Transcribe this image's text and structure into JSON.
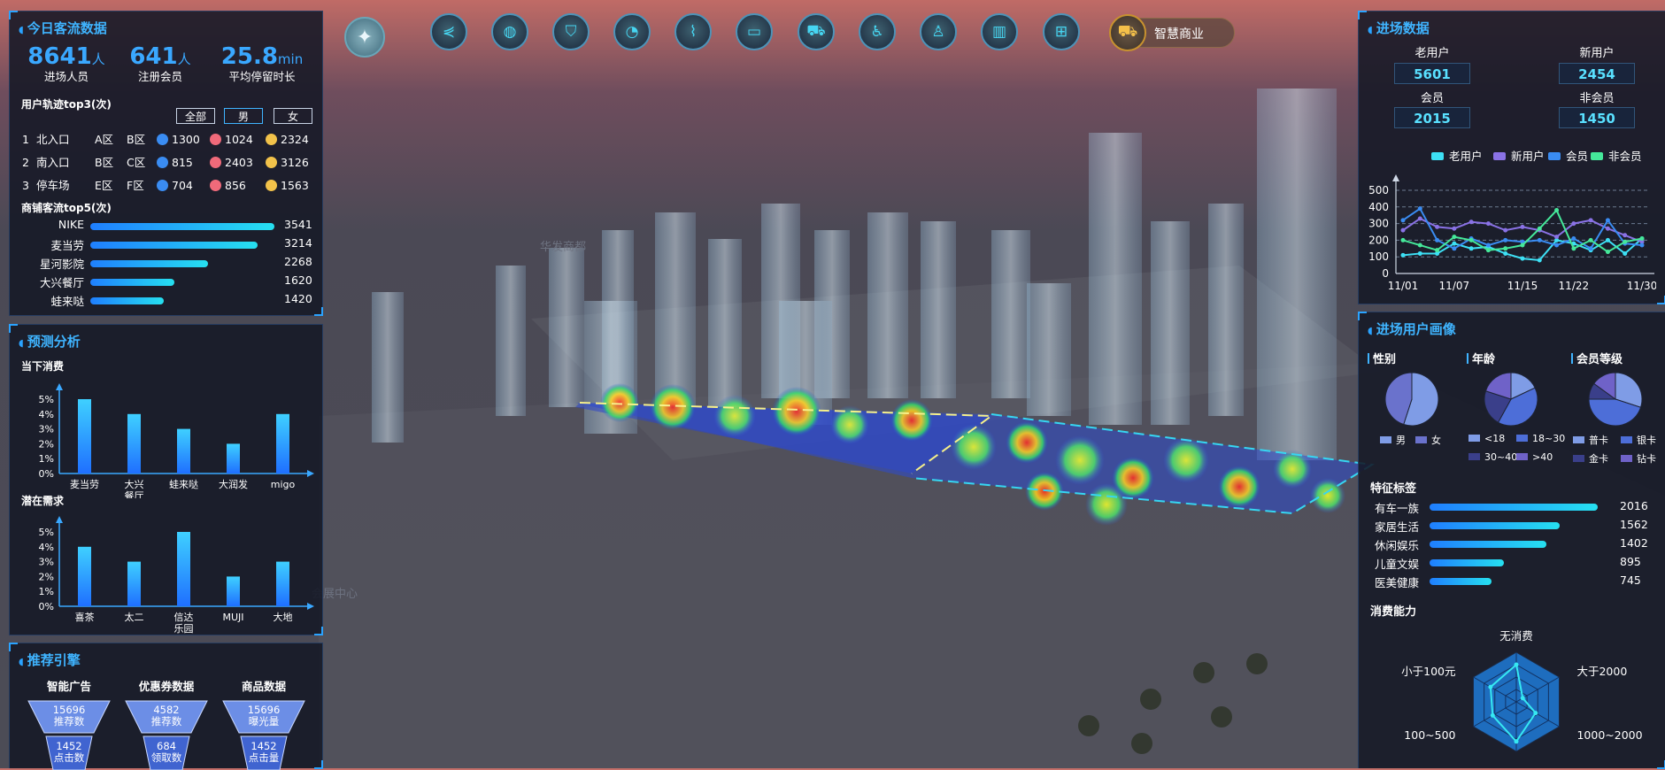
{
  "toolbar": {
    "compass_icon": "compass-icon",
    "icons": [
      "share-icon",
      "globe-icon",
      "shield-icon",
      "speedometer-icon",
      "router-icon",
      "bus-icon",
      "truck-icon",
      "pedestrian-icon",
      "hydrant-icon",
      "building-icon",
      "presentation-icon"
    ],
    "active_label": "智慧商业",
    "active_icon": "shopping-bag-icon"
  },
  "today": {
    "title": "今日客流数据",
    "kpis": [
      {
        "value": "8641",
        "unit": "人",
        "label": "进场人员"
      },
      {
        "value": "641",
        "unit": "人",
        "label": "注册会员"
      },
      {
        "value": "25.8",
        "unit": "min",
        "label": "平均停留时长"
      }
    ],
    "track_title": "用户轨迹top3(次)",
    "filters": [
      "全部",
      "男",
      "女"
    ],
    "tracks": [
      {
        "rank": "1",
        "a": "北入口",
        "b": "A区",
        "c": "B区",
        "n1": "1300",
        "n2": "1024",
        "n3": "2324"
      },
      {
        "rank": "2",
        "a": "南入口",
        "b": "B区",
        "c": "C区",
        "n1": "815",
        "n2": "2403",
        "n3": "3126"
      },
      {
        "rank": "3",
        "a": "停车场",
        "b": "E区",
        "c": "F区",
        "n1": "704",
        "n2": "856",
        "n3": "1563"
      }
    ],
    "shop_title": "商铺客流top5(次)",
    "shops": [
      {
        "name": "NIKE",
        "value": 3541
      },
      {
        "name": "麦当劳",
        "value": 3214
      },
      {
        "name": "星河影院",
        "value": 2268
      },
      {
        "name": "大兴餐厅",
        "value": 1620
      },
      {
        "name": "蛙来哒",
        "value": 1420
      }
    ]
  },
  "forecast": {
    "title": "预测分析",
    "chart_data": [
      {
        "type": "bar",
        "title": "当下消费",
        "categories": [
          "麦当劳",
          "大兴\n餐厅",
          "蛙来哒",
          "大润发",
          "migo"
        ],
        "values": [
          5,
          4,
          3,
          2,
          4
        ],
        "ylim": [
          0,
          5
        ],
        "yticks": [
          "0%",
          "1%",
          "2%",
          "3%",
          "4%",
          "5%"
        ]
      },
      {
        "type": "bar",
        "title": "潜在需求",
        "categories": [
          "喜茶",
          "太二",
          "信达\n乐园",
          "MUJI",
          "大地"
        ],
        "values": [
          4,
          3,
          5,
          2,
          3
        ],
        "ylim": [
          0,
          5
        ],
        "yticks": [
          "0%",
          "1%",
          "2%",
          "3%",
          "4%",
          "5%"
        ]
      }
    ]
  },
  "recommend": {
    "title": "推荐引擎",
    "cols": [
      {
        "head": "智能广告",
        "top_value": "15696",
        "top_label": "推荐数",
        "bot_value": "1452",
        "bot_label": "点击数"
      },
      {
        "head": "优惠券数据",
        "top_value": "4582",
        "top_label": "推荐数",
        "bot_value": "684",
        "bot_label": "领取数"
      },
      {
        "head": "商品数据",
        "top_value": "15696",
        "top_label": "曝光量",
        "bot_value": "1452",
        "bot_label": "点击量"
      }
    ]
  },
  "entry": {
    "title": "进场数据",
    "stats": [
      {
        "label": "老用户",
        "value": "5601"
      },
      {
        "label": "新用户",
        "value": "2454"
      },
      {
        "label": "会员",
        "value": "2015"
      },
      {
        "label": "非会员",
        "value": "1450"
      }
    ],
    "chart_data": {
      "type": "line",
      "x": [
        "11/01",
        "11/03",
        "11/05",
        "11/07",
        "11/09",
        "11/11",
        "11/13",
        "11/15",
        "11/17",
        "11/19",
        "11/22",
        "11/24",
        "11/26",
        "11/28",
        "11/30"
      ],
      "xticks": [
        "11/01",
        "11/07",
        "11/15",
        "11/22",
        "11/30"
      ],
      "ylim": [
        0,
        500
      ],
      "yticks": [
        "0",
        "100",
        "200",
        "300",
        "400",
        "500"
      ],
      "series": [
        {
          "name": "老用户",
          "color": "#3de0f5",
          "values": [
            110,
            120,
            120,
            180,
            150,
            160,
            120,
            90,
            80,
            200,
            180,
            140,
            200,
            120,
            210
          ]
        },
        {
          "name": "新用户",
          "color": "#8a72e6",
          "values": [
            260,
            330,
            280,
            270,
            310,
            300,
            260,
            280,
            260,
            220,
            300,
            320,
            270,
            230,
            190
          ]
        },
        {
          "name": "会员",
          "color": "#3a8cf2",
          "values": [
            320,
            390,
            200,
            150,
            210,
            170,
            200,
            190,
            200,
            170,
            210,
            150,
            320,
            180,
            170
          ]
        },
        {
          "name": "非会员",
          "color": "#45e89a",
          "values": [
            200,
            170,
            140,
            220,
            200,
            140,
            150,
            170,
            270,
            380,
            150,
            200,
            130,
            190,
            210
          ]
        }
      ]
    }
  },
  "portrait": {
    "title": "进场用户画像",
    "pies": [
      {
        "title": "性别",
        "slices": [
          {
            "name": "男",
            "value": 55,
            "color": "#7f9ce6"
          },
          {
            "name": "女",
            "value": 45,
            "color": "#6a72cc"
          }
        ]
      },
      {
        "title": "年龄",
        "slices": [
          {
            "name": "<18",
            "value": 18,
            "color": "#7f9ce6"
          },
          {
            "name": "18~30",
            "value": 40,
            "color": "#4d6ed8"
          },
          {
            "name": "30~40",
            "value": 22,
            "color": "#3a3f8a"
          },
          {
            "name": ">40",
            "value": 20,
            "color": "#6f62c8"
          }
        ]
      },
      {
        "title": "会员等级",
        "slices": [
          {
            "name": "普卡",
            "value": 30,
            "color": "#7f9ce6"
          },
          {
            "name": "银卡",
            "value": 45,
            "color": "#4d6ed8"
          },
          {
            "name": "金卡",
            "value": 10,
            "color": "#3a3f8a"
          },
          {
            "name": "钻卡",
            "value": 15,
            "color": "#6f62c8"
          }
        ]
      }
    ],
    "tag_title": "特征标签",
    "tags": [
      {
        "name": "有车一族",
        "value": 2016
      },
      {
        "name": "家居生活",
        "value": 1562
      },
      {
        "name": "休闲娱乐",
        "value": 1402
      },
      {
        "name": "儿童文娱",
        "value": 895
      },
      {
        "name": "医美健康",
        "value": 745
      }
    ],
    "spend_title": "消费能力",
    "radar": {
      "axes": [
        "无消费",
        "大于2000",
        "1000~2000",
        "500~1000",
        "100~500",
        "小于100元"
      ],
      "values": [
        0.75,
        0.15,
        0.45,
        0.8,
        0.55,
        0.6
      ]
    }
  },
  "map_labels": [
    "华发商都",
    "会展中心"
  ]
}
